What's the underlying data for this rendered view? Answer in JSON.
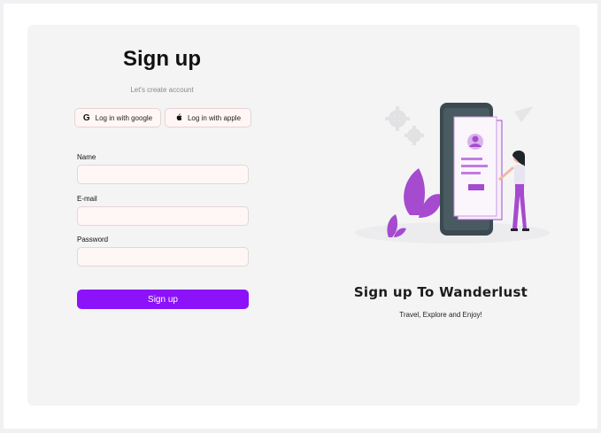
{
  "signup": {
    "title": "Sign up",
    "subtitle": "Let's create account",
    "google_label": "Log in with google",
    "apple_label": "Log in with apple",
    "name_label": "Name",
    "name_value": "",
    "email_label": "E-mail",
    "email_value": "",
    "password_label": "Password",
    "password_value": "",
    "submit_label": "Sign up"
  },
  "promo": {
    "heading": "Sign up To Wanderlust",
    "subheading": "Travel, Explore and Enjoy!"
  },
  "colors": {
    "accent": "#8c12f9",
    "illustration_purple": "#a64ad0",
    "phone_dark": "#3b4a50"
  },
  "icons": {
    "google": "google-icon",
    "apple": "apple-icon"
  }
}
